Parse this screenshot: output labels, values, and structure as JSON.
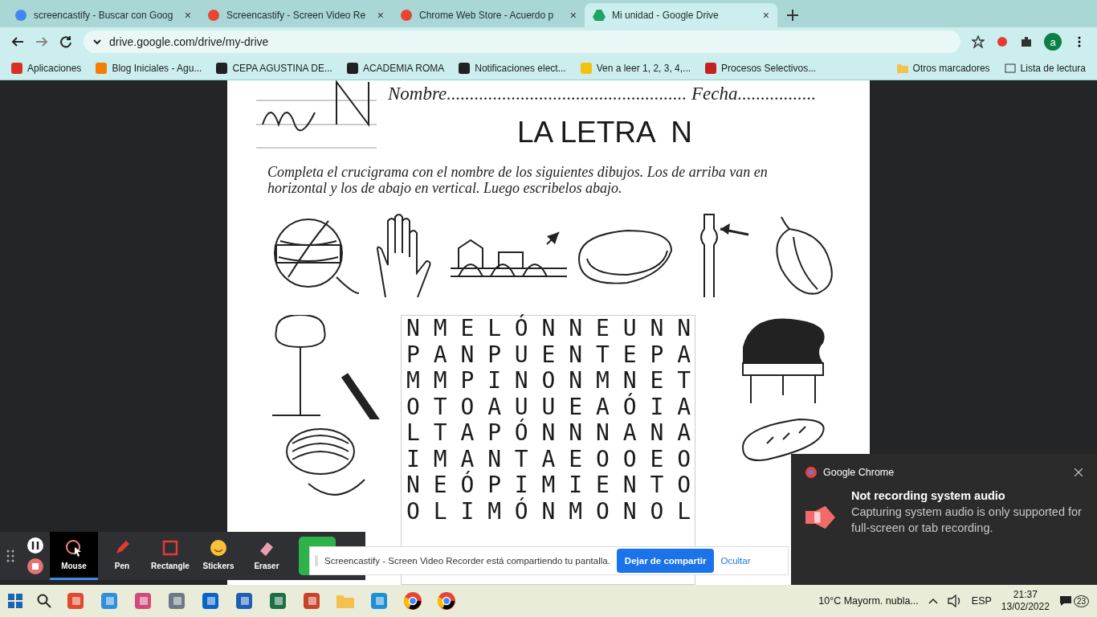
{
  "browser": {
    "tabs": [
      {
        "title": "screencastify - Buscar con Goog",
        "selected": false,
        "close": "×"
      },
      {
        "title": "Screencastify - Screen Video Re",
        "selected": false,
        "close": "×"
      },
      {
        "title": "Chrome Web Store - Acuerdo p",
        "selected": false,
        "close": "×"
      },
      {
        "title": "Mi unidad - Google Drive",
        "selected": true,
        "close": "×"
      }
    ],
    "address": "drive.google.com/drive/my-drive",
    "profile_initial": "a",
    "bookmarks": [
      {
        "label": "Aplicaciones",
        "color": "#d93025"
      },
      {
        "label": "Blog Iniciales - Agu...",
        "color": "#f57c00"
      },
      {
        "label": "CEPA AGUSTINA DE...",
        "color": "#202124"
      },
      {
        "label": "ACADEMIA ROMA",
        "color": "#202124"
      },
      {
        "label": "Notificaciones elect...",
        "color": "#202124"
      },
      {
        "label": "Ven a leer 1, 2, 3, 4,...",
        "color": "#f4c20d"
      },
      {
        "label": "Procesos Selectivos...",
        "color": "#c5221f"
      }
    ],
    "other_bookmarks": "Otros marcadores",
    "reading_list": "Lista de lectura"
  },
  "worksheet": {
    "name_line": "Nombre.................................................... Fecha.................",
    "title": "LA LETRA  N",
    "instructions": "Completa el crucigrama con el nombre de los siguientes dibujos. Los de arriba van en horizontal y los de abajo en vertical. Luego escribelos abajo.",
    "grid": [
      "N M E L Ó N N E U N N",
      "P A N P U E N T E P A",
      "M M P I N O N M N E T",
      "O T O A U U E A Ó I A",
      "L T A P Ó N N N A N A",
      "I M A N T A E O O E O",
      "N E Ó P I M I E N T O",
      "O L I M Ó N M O N O L"
    ]
  },
  "recorder_toolbar": {
    "tools": [
      {
        "label": "Mouse",
        "kind": "mouse",
        "selected": true
      },
      {
        "label": "Pen",
        "kind": "pen",
        "selected": false
      },
      {
        "label": "Rectangle",
        "kind": "rectangle",
        "selected": false
      },
      {
        "label": "Stickers",
        "kind": "stickers",
        "selected": false
      },
      {
        "label": "Eraser",
        "kind": "eraser",
        "selected": false
      }
    ]
  },
  "share_bar": {
    "message": "Screencastify - Screen Video Recorder está compartiendo tu pantalla.",
    "stop_button": "Dejar de compartir",
    "hide_link": "Ocultar"
  },
  "notification": {
    "app": "Google Chrome",
    "title": "Not recording system audio",
    "body": "Capturing system audio is only supported for full-screen or tab recording."
  },
  "taskbar": {
    "apps": [
      {
        "kind": "app",
        "color": "#e04a2f"
      },
      {
        "kind": "app",
        "color": "#2f8fd8"
      },
      {
        "kind": "app",
        "color": "#d04a7a"
      },
      {
        "kind": "app",
        "color": "#6b7a86"
      },
      {
        "kind": "app",
        "color": "#0a64c8"
      },
      {
        "kind": "app",
        "color": "#1e5fb4"
      },
      {
        "kind": "app",
        "color": "#1d7044"
      },
      {
        "kind": "app",
        "color": "#c8432a"
      },
      {
        "kind": "folder",
        "color": "#f2c14e"
      },
      {
        "kind": "app",
        "color": "#1f8fd6"
      },
      {
        "kind": "chrome"
      },
      {
        "kind": "chrome"
      }
    ],
    "weather": "10°C  Mayorm. nubla...",
    "language": "ESP",
    "time": "21:37",
    "date": "13/02/2022",
    "notifications": "23"
  }
}
